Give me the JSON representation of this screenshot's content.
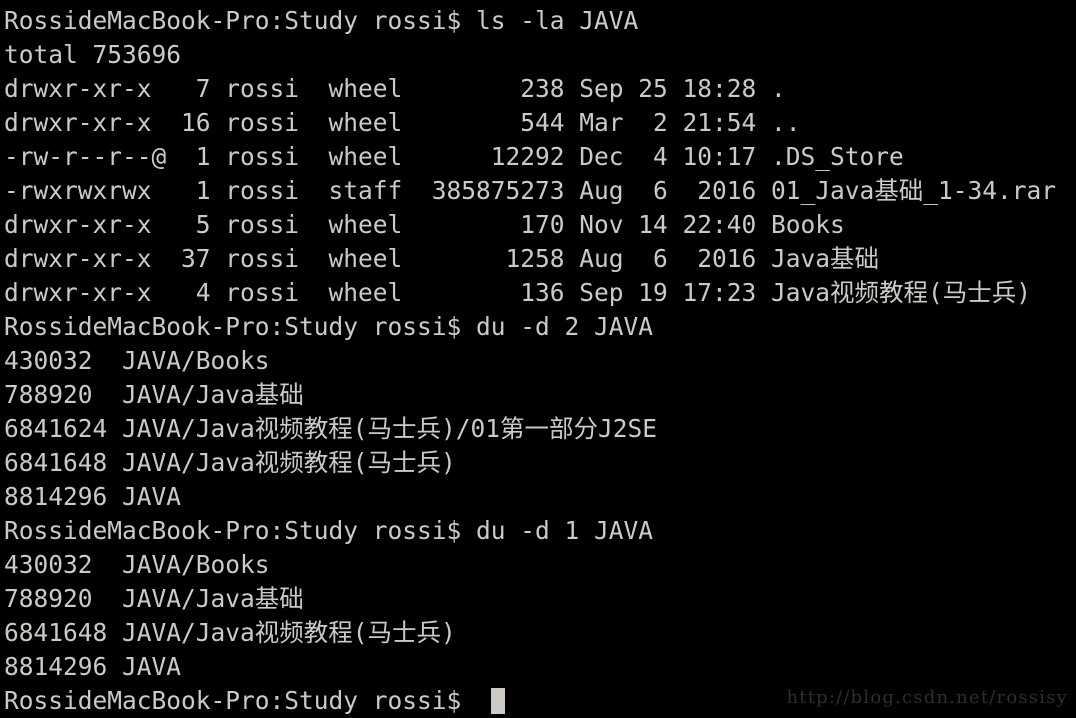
{
  "terminal": {
    "title": "Terminal",
    "prompt": "RossideMacBook-Pro:Study rossi$ ",
    "colors": {
      "background": "#000000",
      "foreground": "#cdc9c5",
      "cursor": "#cdc9c5",
      "watermark": "#2e2e2e"
    },
    "lines": [
      "RossideMacBook-Pro:Study rossi$ ls -la JAVA",
      "total 753696",
      "drwxr-xr-x   7 rossi  wheel        238 Sep 25 18:28 .",
      "drwxr-xr-x  16 rossi  wheel        544 Mar  2 21:54 ..",
      "-rw-r--r--@  1 rossi  wheel      12292 Dec  4 10:17 .DS_Store",
      "-rwxrwxrwx   1 rossi  staff  385875273 Aug  6  2016 01_Java基础_1-34.rar",
      "drwxr-xr-x   5 rossi  wheel        170 Nov 14 22:40 Books",
      "drwxr-xr-x  37 rossi  wheel       1258 Aug  6  2016 Java基础",
      "drwxr-xr-x   4 rossi  wheel        136 Sep 19 17:23 Java视频教程(马士兵)",
      "RossideMacBook-Pro:Study rossi$ du -d 2 JAVA",
      "430032\tJAVA/Books",
      "788920\tJAVA/Java基础",
      "6841624\tJAVA/Java视频教程(马士兵)/01第一部分J2SE",
      "6841648\tJAVA/Java视频教程(马士兵)",
      "8814296\tJAVA",
      "RossideMacBook-Pro:Study rossi$ du -d 1 JAVA",
      "430032\tJAVA/Books",
      "788920\tJAVA/Java基础",
      "6841648\tJAVA/Java视频教程(马士兵)",
      "8814296\tJAVA",
      "RossideMacBook-Pro:Study rossi$ "
    ],
    "cursor_line_index": 20,
    "commands": [
      "ls -la JAVA",
      "du -d 2 JAVA",
      "du -d 1 JAVA"
    ],
    "listing": {
      "total": "total 753696",
      "columns": [
        "permissions",
        "links",
        "owner",
        "group",
        "size",
        "month",
        "day",
        "time",
        "name"
      ],
      "entries": [
        {
          "permissions": "drwxr-xr-x",
          "links": "7",
          "owner": "rossi",
          "group": "wheel",
          "size": "238",
          "month": "Sep",
          "day": "25",
          "time": "18:28",
          "name": "."
        },
        {
          "permissions": "drwxr-xr-x",
          "links": "16",
          "owner": "rossi",
          "group": "wheel",
          "size": "544",
          "month": "Mar",
          "day": "2",
          "time": "21:54",
          "name": ".."
        },
        {
          "permissions": "-rw-r--r--@",
          "links": "1",
          "owner": "rossi",
          "group": "wheel",
          "size": "12292",
          "month": "Dec",
          "day": "4",
          "time": "10:17",
          "name": ".DS_Store"
        },
        {
          "permissions": "-rwxrwxrwx",
          "links": "1",
          "owner": "rossi",
          "group": "staff",
          "size": "385875273",
          "month": "Aug",
          "day": "6",
          "time": "2016",
          "name": "01_Java基础_1-34.rar"
        },
        {
          "permissions": "drwxr-xr-x",
          "links": "5",
          "owner": "rossi",
          "group": "wheel",
          "size": "170",
          "month": "Nov",
          "day": "14",
          "time": "22:40",
          "name": "Books"
        },
        {
          "permissions": "drwxr-xr-x",
          "links": "37",
          "owner": "rossi",
          "group": "wheel",
          "size": "1258",
          "month": "Aug",
          "day": "6",
          "time": "2016",
          "name": "Java基础"
        },
        {
          "permissions": "drwxr-xr-x",
          "links": "4",
          "owner": "rossi",
          "group": "wheel",
          "size": "136",
          "month": "Sep",
          "day": "19",
          "time": "17:23",
          "name": "Java视频教程(马士兵)"
        }
      ]
    },
    "du_depth2": [
      {
        "size": "430032",
        "path": "JAVA/Books"
      },
      {
        "size": "788920",
        "path": "JAVA/Java基础"
      },
      {
        "size": "6841624",
        "path": "JAVA/Java视频教程(马士兵)/01第一部分J2SE"
      },
      {
        "size": "6841648",
        "path": "JAVA/Java视频教程(马士兵)"
      },
      {
        "size": "8814296",
        "path": "JAVA"
      }
    ],
    "du_depth1": [
      {
        "size": "430032",
        "path": "JAVA/Books"
      },
      {
        "size": "788920",
        "path": "JAVA/Java基础"
      },
      {
        "size": "6841648",
        "path": "JAVA/Java视频教程(马士兵)"
      },
      {
        "size": "8814296",
        "path": "JAVA"
      }
    ]
  },
  "watermark": {
    "text": "http://blog.csdn.net/rossisy"
  }
}
